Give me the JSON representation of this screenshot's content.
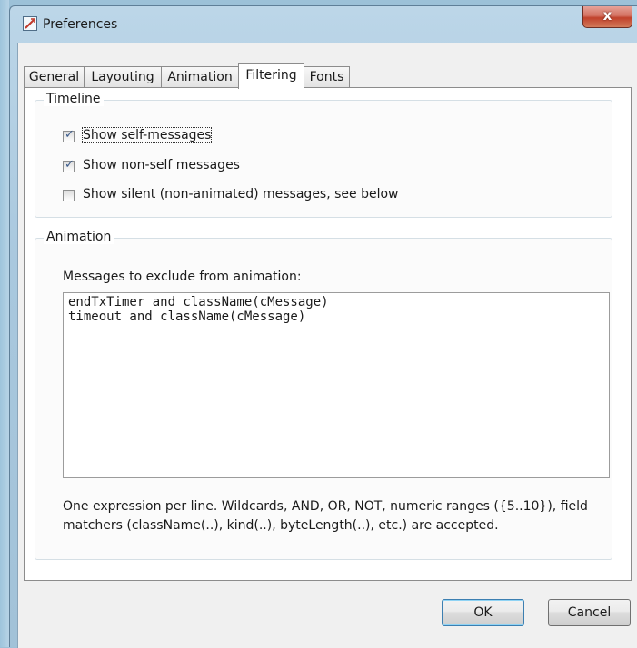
{
  "window": {
    "title": "Preferences",
    "close_glyph": "x"
  },
  "tabs": [
    {
      "label": "General",
      "active": false
    },
    {
      "label": "Layouting",
      "active": false
    },
    {
      "label": "Animation",
      "active": false
    },
    {
      "label": "Filtering",
      "active": true
    },
    {
      "label": "Fonts",
      "active": false
    }
  ],
  "timeline": {
    "title": "Timeline",
    "options": [
      {
        "label": "Show self-messages",
        "checked": true
      },
      {
        "label": "Show non-self messages",
        "checked": true
      },
      {
        "label": "Show silent (non-animated) messages, see below",
        "checked": false
      }
    ]
  },
  "animation": {
    "title": "Animation",
    "exclude_label": "Messages to exclude from animation:",
    "exclude_text": "endTxTimer and className(cMessage)\ntimeout and className(cMessage)",
    "note": "One expression per line. Wildcards, AND, OR, NOT, numeric ranges ({5..10}), field matchers (className(..), kind(..), byteLength(..), etc.) are accepted."
  },
  "buttons": {
    "ok": "OK",
    "cancel": "Cancel"
  },
  "icons": {
    "app": "preferences-app-icon",
    "check": "checkmark-icon"
  },
  "colors": {
    "check": "#3c5b8a",
    "close": "#c0412b"
  }
}
